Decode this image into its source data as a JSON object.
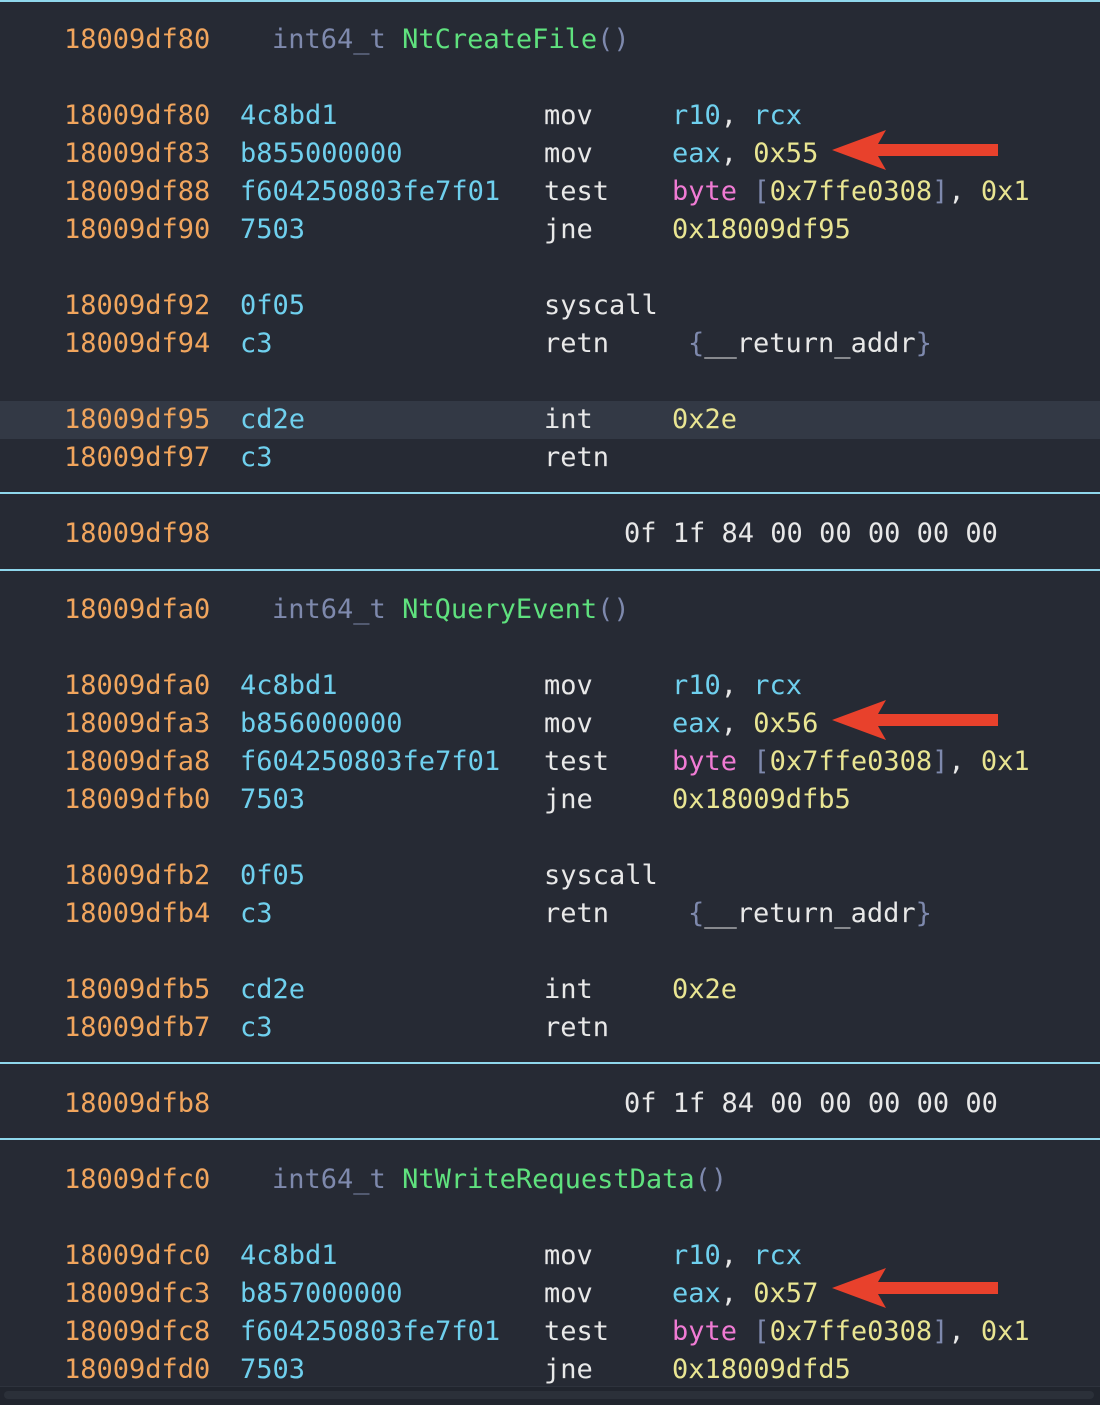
{
  "functions": [
    {
      "header_addr": "18009df80",
      "type": "int64_t",
      "name": "NtCreateFile",
      "parens": "()",
      "rows": [
        {
          "addr": "18009df80",
          "bytes": "4c8bd1",
          "mnemonic": "mov",
          "operands": "r10, rcx"
        },
        {
          "addr": "18009df83",
          "bytes": "b855000000",
          "mnemonic": "mov",
          "operands": "eax, 0x55"
        },
        {
          "addr": "18009df88",
          "bytes": "f604250803fe7f01",
          "mnemonic": "test",
          "operands": "byte [0x7ffe0308], 0x1"
        },
        {
          "addr": "18009df90",
          "bytes": "7503",
          "mnemonic": "jne",
          "operands": "0x18009df95"
        },
        {
          "addr": "18009df92",
          "bytes": "0f05",
          "mnemonic": "syscall",
          "operands": ""
        },
        {
          "addr": "18009df94",
          "bytes": "c3",
          "mnemonic": "retn",
          "operands": "{__return_addr}"
        },
        {
          "addr": "18009df95",
          "bytes": "cd2e",
          "mnemonic": "int",
          "operands": "0x2e"
        },
        {
          "addr": "18009df97",
          "bytes": "c3",
          "mnemonic": "retn",
          "operands": ""
        }
      ],
      "padding": {
        "addr": "18009df98",
        "bytes": "0f 1f 84 00 00 00 00 00"
      }
    },
    {
      "header_addr": "18009dfa0",
      "type": "int64_t",
      "name": "NtQueryEvent",
      "parens": "()",
      "rows": [
        {
          "addr": "18009dfa0",
          "bytes": "4c8bd1",
          "mnemonic": "mov",
          "operands": "r10, rcx"
        },
        {
          "addr": "18009dfa3",
          "bytes": "b856000000",
          "mnemonic": "mov",
          "operands": "eax, 0x56"
        },
        {
          "addr": "18009dfa8",
          "bytes": "f604250803fe7f01",
          "mnemonic": "test",
          "operands": "byte [0x7ffe0308], 0x1"
        },
        {
          "addr": "18009dfb0",
          "bytes": "7503",
          "mnemonic": "jne",
          "operands": "0x18009dfb5"
        },
        {
          "addr": "18009dfb2",
          "bytes": "0f05",
          "mnemonic": "syscall",
          "operands": ""
        },
        {
          "addr": "18009dfb4",
          "bytes": "c3",
          "mnemonic": "retn",
          "operands": "{__return_addr}"
        },
        {
          "addr": "18009dfb5",
          "bytes": "cd2e",
          "mnemonic": "int",
          "operands": "0x2e"
        },
        {
          "addr": "18009dfb7",
          "bytes": "c3",
          "mnemonic": "retn",
          "operands": ""
        }
      ],
      "padding": {
        "addr": "18009dfb8",
        "bytes": "0f 1f 84 00 00 00 00 00"
      }
    },
    {
      "header_addr": "18009dfc0",
      "type": "int64_t",
      "name": "NtWriteRequestData",
      "parens": "()",
      "rows": [
        {
          "addr": "18009dfc0",
          "bytes": "4c8bd1",
          "mnemonic": "mov",
          "operands": "r10, rcx"
        },
        {
          "addr": "18009dfc3",
          "bytes": "b857000000",
          "mnemonic": "mov",
          "operands": "eax, 0x57"
        },
        {
          "addr": "18009dfc8",
          "bytes": "f604250803fe7f01",
          "mnemonic": "test",
          "operands": "byte [0x7ffe0308], 0x1"
        },
        {
          "addr": "18009dfd0",
          "bytes": "7503",
          "mnemonic": "jne",
          "operands": "0x18009dfd5"
        }
      ]
    }
  ],
  "colors": {
    "background": "#262a34",
    "address": "#f1a55d",
    "bytes": "#6fd0ee",
    "function_name": "#5fe17e",
    "immediate": "#e9e592",
    "keyword_byte": "#f07bd4",
    "separator": "#8fd7ec",
    "annotation_arrow": "#e8412c"
  },
  "annotations": {
    "arrow_icon": "red-left-arrow",
    "count": 3
  }
}
